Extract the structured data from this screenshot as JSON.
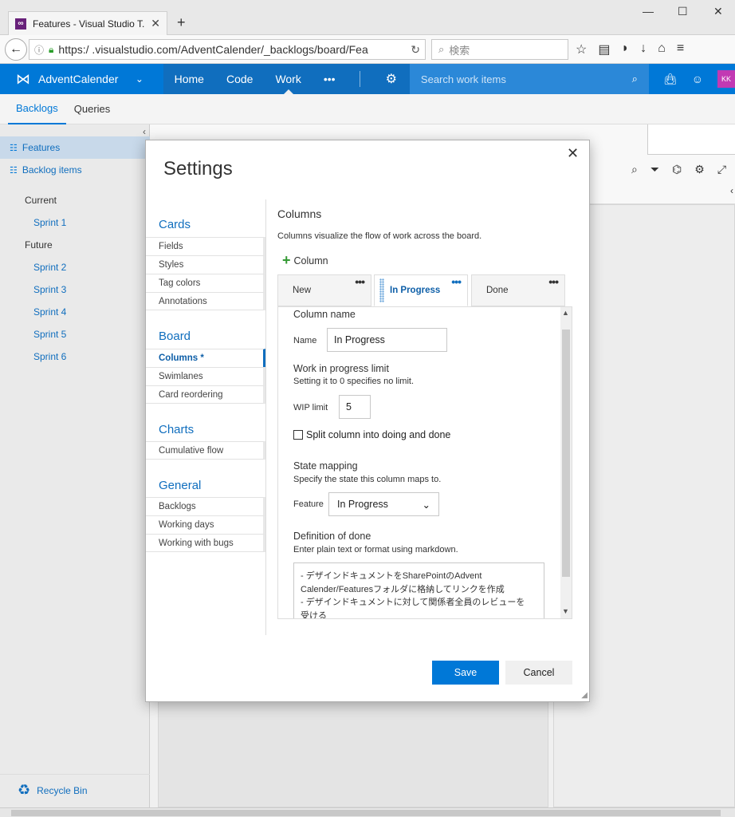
{
  "browser": {
    "tab_title": "Features - Visual Studio T...",
    "url": "https:/            .visualstudio.com/AdventCalender/_backlogs/board/Fea",
    "search_placeholder": "検索"
  },
  "header": {
    "project": "AdventCalender",
    "nav": [
      "Home",
      "Code",
      "Work"
    ],
    "more": "•••",
    "search_placeholder": "Search work items",
    "avatar": "KK",
    "brand_color": "#0078d7"
  },
  "hubs": [
    "Backlogs",
    "Queries"
  ],
  "leftnav": {
    "backlogs": [
      {
        "label": "Features",
        "icon": "features-icon"
      },
      {
        "label": "Backlog items",
        "icon": "backlog-items-icon"
      }
    ],
    "current_label": "Current",
    "current_sprints": [
      "Sprint 1"
    ],
    "future_label": "Future",
    "future_sprints": [
      "Sprint 2",
      "Sprint 3",
      "Sprint 4",
      "Sprint 5",
      "Sprint 6"
    ],
    "recycle_bin": "Recycle Bin"
  },
  "dialog": {
    "title": "Settings",
    "nav": {
      "cards": {
        "label": "Cards",
        "items": [
          "Fields",
          "Styles",
          "Tag colors",
          "Annotations"
        ]
      },
      "board": {
        "label": "Board",
        "items": [
          "Columns *",
          "Swimlanes",
          "Card reordering"
        ]
      },
      "charts": {
        "label": "Charts",
        "items": [
          "Cumulative flow"
        ]
      },
      "general": {
        "label": "General",
        "items": [
          "Backlogs",
          "Working days",
          "Working with bugs"
        ]
      }
    },
    "pane": {
      "title": "Columns",
      "description": "Columns visualize the flow of work across the board.",
      "add_column": "Column",
      "tabs": [
        "New",
        "In Progress",
        "Done"
      ],
      "tab_menu": "•••",
      "column_name_heading": "Column name",
      "name_label": "Name",
      "name_value": "In Progress",
      "wip_heading": "Work in progress limit",
      "wip_desc": "Setting it to 0 specifies no limit.",
      "wip_label": "WIP limit",
      "wip_value": "5",
      "split_label": "Split column into doing and done",
      "state_heading": "State mapping",
      "state_desc": "Specify the state this column maps to.",
      "feature_label": "Feature",
      "feature_value": "In Progress",
      "dod_heading": "Definition of done",
      "dod_desc": "Enter plain text or format using markdown.",
      "dod_text": "- デザインドキュメントをSharePointのAdvent\nCalender/Featuresフォルダに格納してリンクを作成\n- デザインドキュメントに対して関係者全員のレビューを\n受ける"
    },
    "save": "Save",
    "cancel": "Cancel"
  }
}
